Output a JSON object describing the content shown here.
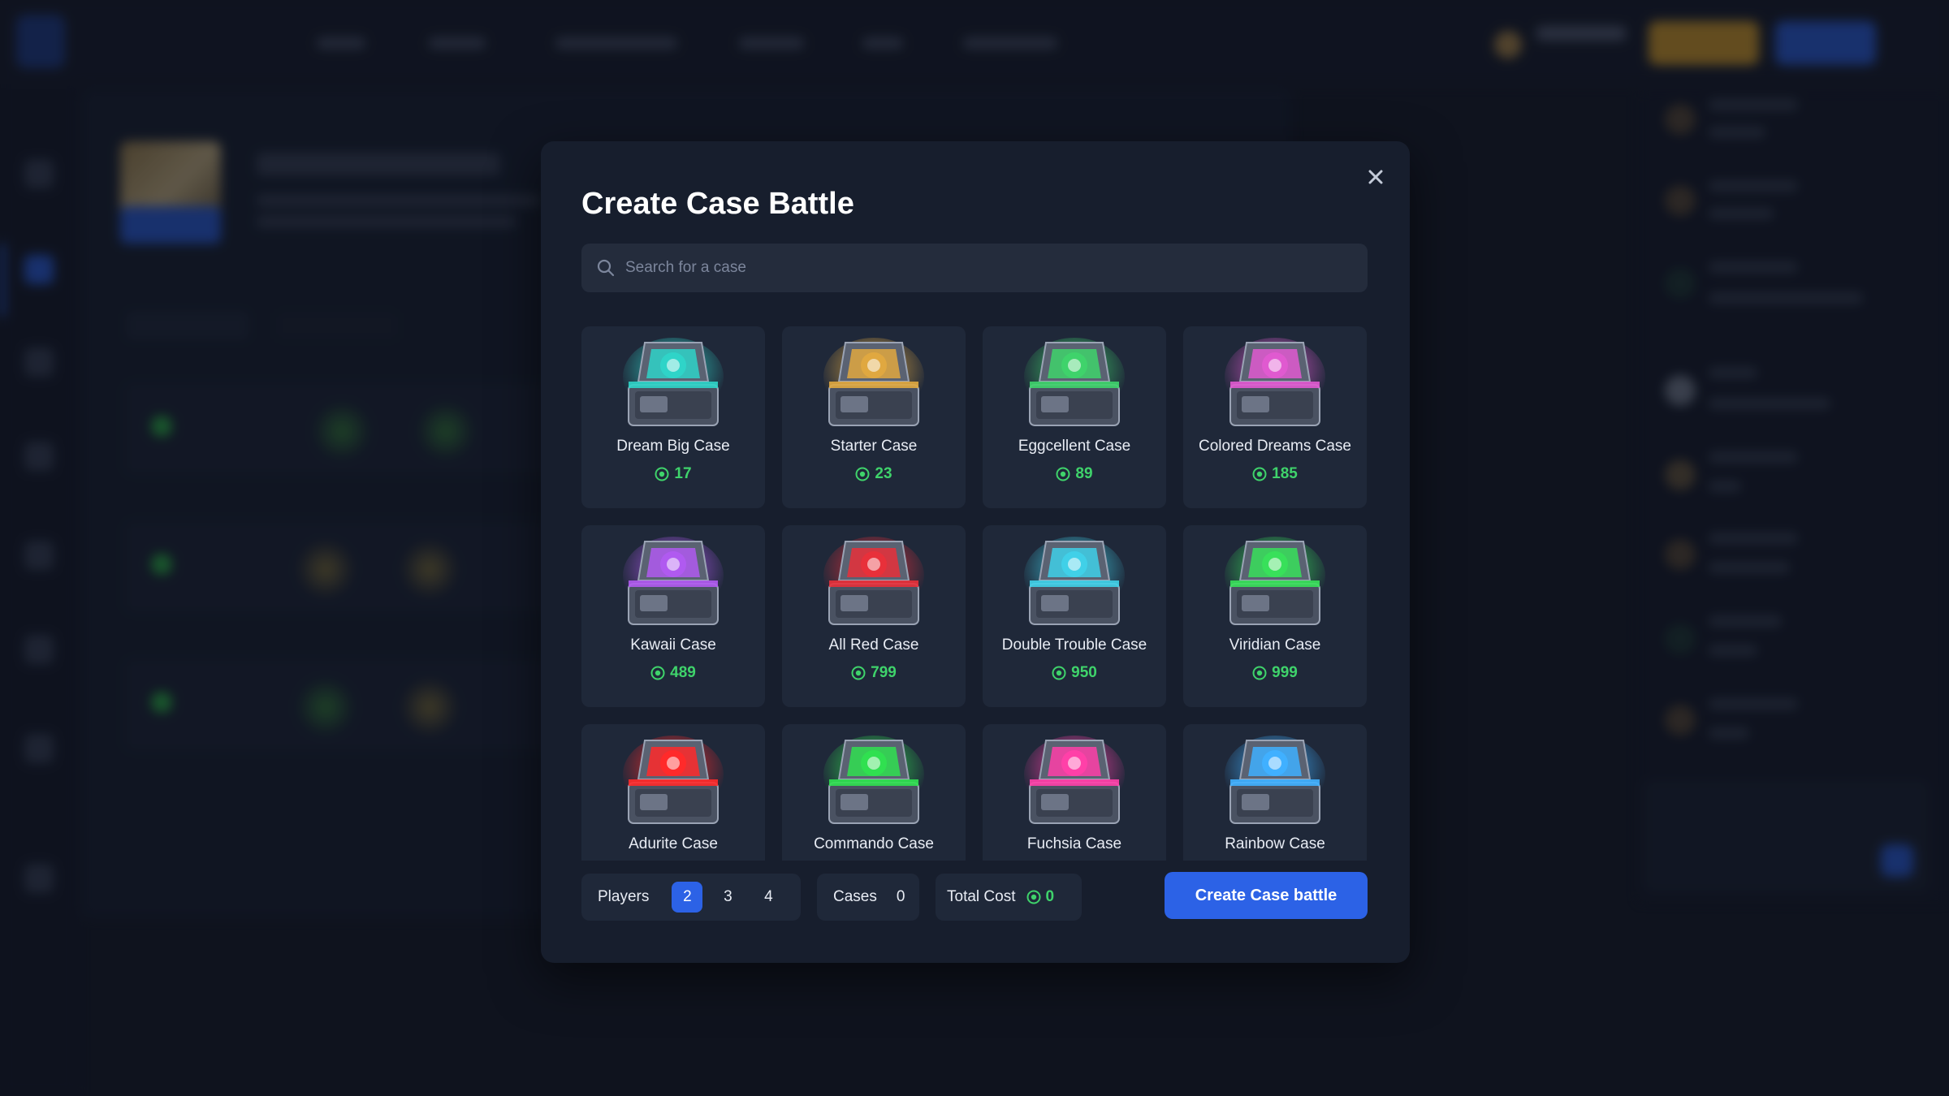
{
  "modal": {
    "title": "Create Case Battle",
    "search_placeholder": "Search for a case"
  },
  "cases": [
    {
      "name": "Dream Big Case",
      "price": "17",
      "theme": "#2fd4c8"
    },
    {
      "name": "Starter Case",
      "price": "23",
      "theme": "#e0a840"
    },
    {
      "name": "Eggcellent Case",
      "price": "89",
      "theme": "#3fd36b"
    },
    {
      "name": "Colored Dreams Case",
      "price": "185",
      "theme": "#e05ad0"
    },
    {
      "name": "Kawaii Case",
      "price": "489",
      "theme": "#b05af0"
    },
    {
      "name": "All Red Case",
      "price": "799",
      "theme": "#e8303a"
    },
    {
      "name": "Double Trouble Case",
      "price": "950",
      "theme": "#40d0e8"
    },
    {
      "name": "Viridian Case",
      "price": "999",
      "theme": "#38e05a"
    },
    {
      "name": "Adurite Case",
      "price": "",
      "theme": "#ff2a2a"
    },
    {
      "name": "Commando Case",
      "price": "",
      "theme": "#30e050"
    },
    {
      "name": "Fuchsia Case",
      "price": "",
      "theme": "#ff40a8"
    },
    {
      "name": "Rainbow Case",
      "price": "",
      "theme": "#40b0ff"
    }
  ],
  "footer": {
    "players_label": "Players",
    "player_options": [
      "2",
      "3",
      "4"
    ],
    "selected_players": "2",
    "cases_label": "Cases",
    "cases_count": "0",
    "total_cost_label": "Total Cost",
    "total_cost_value": "0",
    "create_button": "Create Case battle"
  },
  "colors": {
    "accent": "#2c62e6",
    "currency": "#3fd36b",
    "card_bg": "#1f2839",
    "modal_bg": "#171e2d"
  }
}
